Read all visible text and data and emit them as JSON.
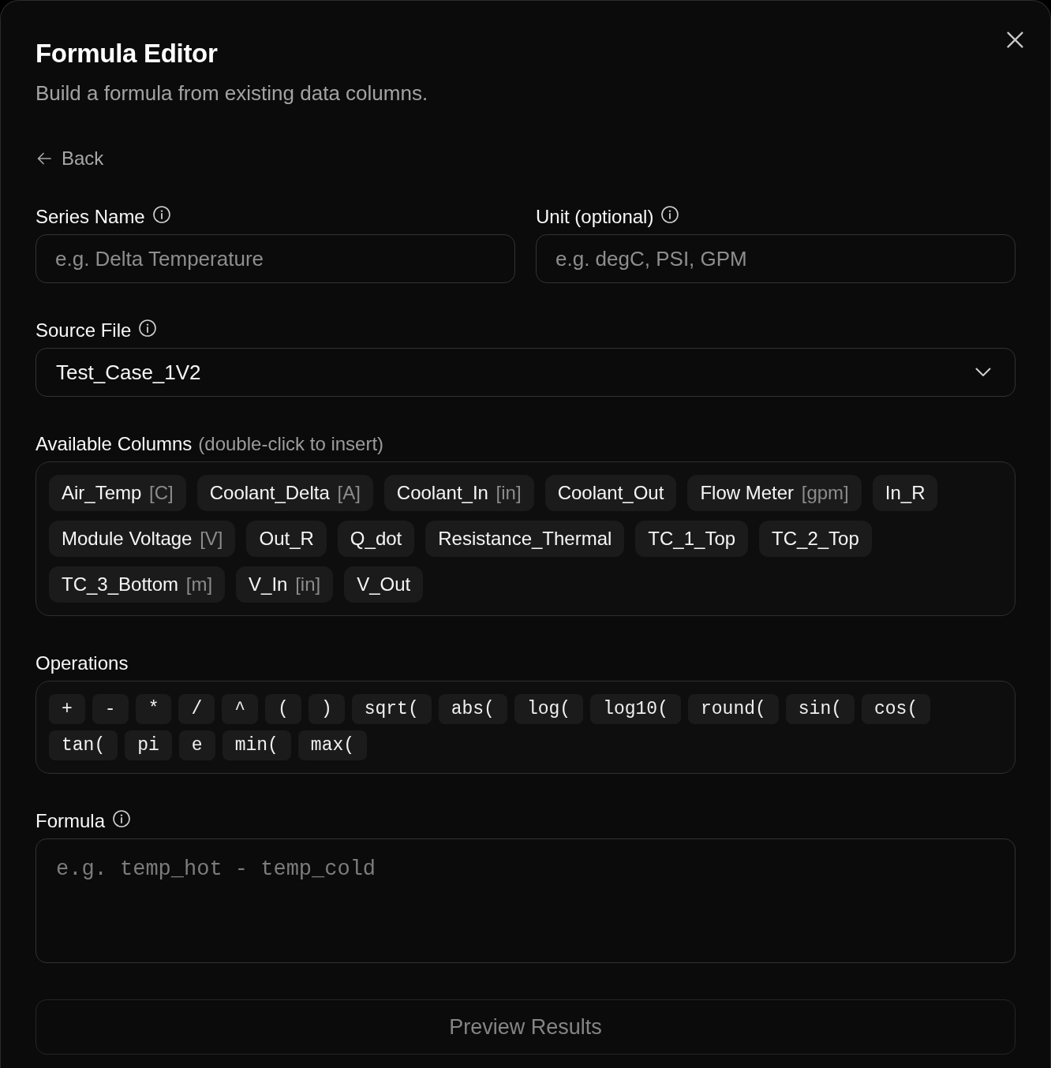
{
  "dialog": {
    "title": "Formula Editor",
    "subtitle": "Build a formula from existing data columns."
  },
  "back_link": {
    "label": "Back"
  },
  "fields": [
    {
      "kind": "text",
      "label": "Series Name",
      "info": true,
      "placeholder": "e.g. Delta Temperature"
    },
    {
      "kind": "text",
      "label": "Unit (optional)",
      "info": true,
      "placeholder": "e.g. degC, PSI, GPM"
    }
  ],
  "source_file": {
    "label": "Source File",
    "info": true,
    "value": "Test_Case_1V2"
  },
  "available_columns": {
    "label": "Available Columns",
    "info": false,
    "hint": "(double-click to insert)",
    "columns": [
      {
        "name": "Air_Temp",
        "unit": "[C]"
      },
      {
        "name": "Coolant_Delta",
        "unit": "[A]"
      },
      {
        "name": "Coolant_In",
        "unit": "[in]"
      },
      {
        "name": "Coolant_Out"
      },
      {
        "name": "Flow Meter",
        "unit": "[gpm]"
      },
      {
        "name": "In_R"
      },
      {
        "name": "Module Voltage",
        "unit": "[V]"
      },
      {
        "name": "Out_R"
      },
      {
        "name": "Q_dot"
      },
      {
        "name": "Resistance_Thermal"
      },
      {
        "name": "TC_1_Top"
      },
      {
        "name": "TC_2_Top"
      },
      {
        "name": "TC_3_Bottom",
        "unit": "[m]"
      },
      {
        "name": "V_In",
        "unit": "[in]"
      },
      {
        "name": "V_Out"
      }
    ]
  },
  "operations": {
    "label": "Operations",
    "info": false,
    "items": [
      "+",
      "-",
      "*",
      "/",
      "^",
      "(",
      ")",
      "sqrt(",
      "abs(",
      "log(",
      "log10(",
      "round(",
      "sin(",
      "cos(",
      "tan(",
      "pi",
      "e",
      "min(",
      "max("
    ]
  },
  "formula": {
    "label": "Formula",
    "info": true,
    "placeholder": "e.g. temp_hot - temp_cold"
  },
  "preview_button": {
    "label": "Preview Results",
    "disabled": true
  }
}
